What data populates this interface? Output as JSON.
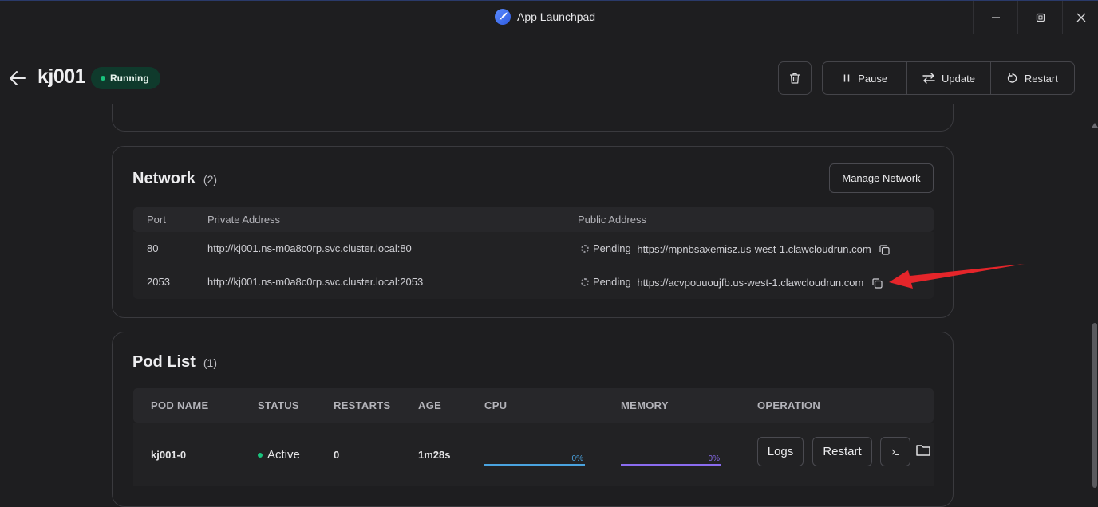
{
  "window": {
    "title": "App Launchpad",
    "minimize_icon": "minimize-icon",
    "restore_icon": "restore-icon",
    "close_icon": "close-icon"
  },
  "header": {
    "app_name": "kj001",
    "status": "Running",
    "status_color": "#19c37d",
    "actions": {
      "pause": "Pause",
      "update": "Update",
      "restart": "Restart"
    }
  },
  "network": {
    "title": "Network",
    "count": "(2)",
    "manage_label": "Manage Network",
    "columns": {
      "port": "Port",
      "private": "Private Address",
      "public": "Public Address"
    },
    "rows": [
      {
        "port": "80",
        "private": "http://kj001.ns-m0a8c0rp.svc.cluster.local:80",
        "status": "Pending",
        "public": "https://mpnbsaxemisz.us-west-1.clawcloudrun.com"
      },
      {
        "port": "2053",
        "private": "http://kj001.ns-m0a8c0rp.svc.cluster.local:2053",
        "status": "Pending",
        "public": "https://acvpouuoujfb.us-west-1.clawcloudrun.com"
      }
    ]
  },
  "pods": {
    "title": "Pod List",
    "count": "(1)",
    "columns": {
      "name": "POD NAME",
      "status": "STATUS",
      "restarts": "RESTARTS",
      "age": "AGE",
      "cpu": "CPU",
      "memory": "MEMORY",
      "operation": "OPERATION"
    },
    "rows": [
      {
        "name": "kj001-0",
        "status": "Active",
        "restarts": "0",
        "age": "1m28s",
        "cpu": "0%",
        "memory": "0%",
        "logs_label": "Logs",
        "restart_label": "Restart"
      }
    ],
    "cpu_color": "#4aa3df",
    "memory_color": "#8b6cf0"
  },
  "annotation": {
    "arrow_color": "#e5252a"
  }
}
